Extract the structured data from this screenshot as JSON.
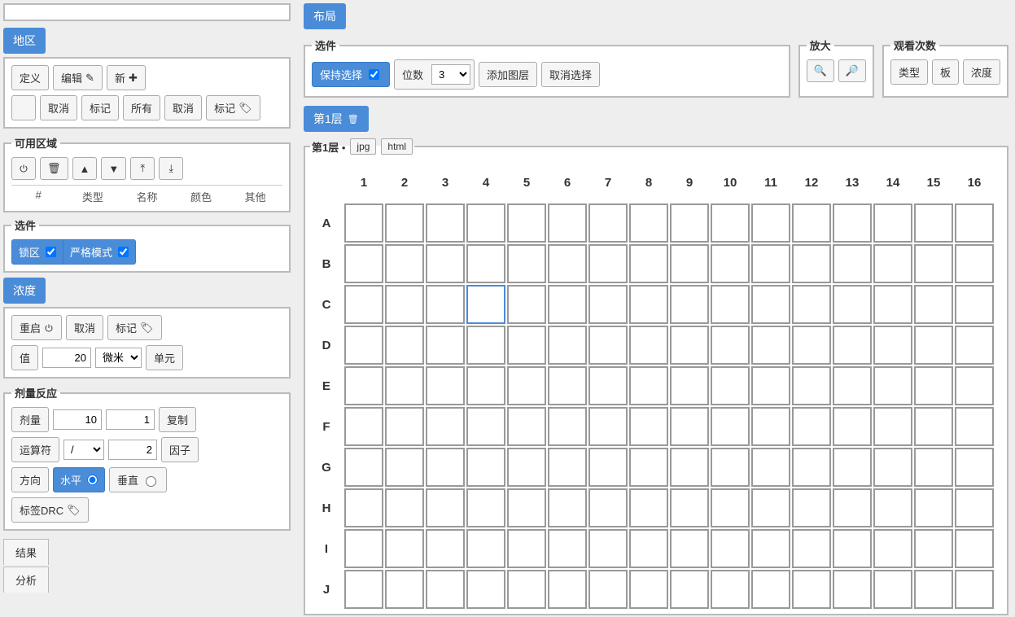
{
  "sidebar": {
    "region": {
      "title": "地区",
      "define": "定义",
      "edit": "编辑",
      "new": "新",
      "cancel": "取消",
      "mark": "标记",
      "all": "所有",
      "cancel2": "取消",
      "mark2": "标记"
    },
    "available_area": {
      "title": "可用区域",
      "headers": {
        "hash": "#",
        "type": "类型",
        "name": "名称",
        "color": "颜色",
        "other": "其他"
      }
    },
    "options": {
      "title": "选件",
      "lock_zone": "锁区",
      "strict_mode": "严格模式"
    },
    "concentration": {
      "title": "浓度",
      "restart": "重启",
      "cancel": "取消",
      "mark": "标记",
      "value_label": "值",
      "value": "20",
      "unit_select": "微米",
      "unit_label": "单元"
    },
    "dose_response": {
      "title": "剂量反应",
      "dose_label": "剂量",
      "dose_value": "10",
      "copies_value": "1",
      "copy_label": "复制",
      "operator_label": "运算符",
      "operator_value": "/",
      "factor_value": "2",
      "factor_label": "因子",
      "direction_label": "方向",
      "horizontal": "水平",
      "vertical": "垂直",
      "tag_drc": "标签DRC"
    },
    "tabs": {
      "results": "结果",
      "analysis": "分析"
    }
  },
  "main": {
    "layout_title": "布局",
    "options": {
      "title": "选件",
      "keep_selection": "保持选择",
      "digits_label": "位数",
      "digits_value": "3",
      "add_layer": "添加图层",
      "deselect": "取消选择"
    },
    "zoom": {
      "title": "放大"
    },
    "view_count": {
      "title": "观看次数",
      "type": "类型",
      "board": "板",
      "concentration": "浓度"
    },
    "layer_tab": "第1层",
    "grid_legend": "第1层",
    "fmt_jpg": "jpg",
    "fmt_html": "html",
    "columns": [
      "1",
      "2",
      "3",
      "4",
      "5",
      "6",
      "7",
      "8",
      "9",
      "10",
      "11",
      "12",
      "13",
      "14",
      "15",
      "16"
    ],
    "rows": [
      "A",
      "B",
      "C",
      "D",
      "E",
      "F",
      "G",
      "H",
      "I",
      "J"
    ],
    "selected_well": "C4"
  }
}
